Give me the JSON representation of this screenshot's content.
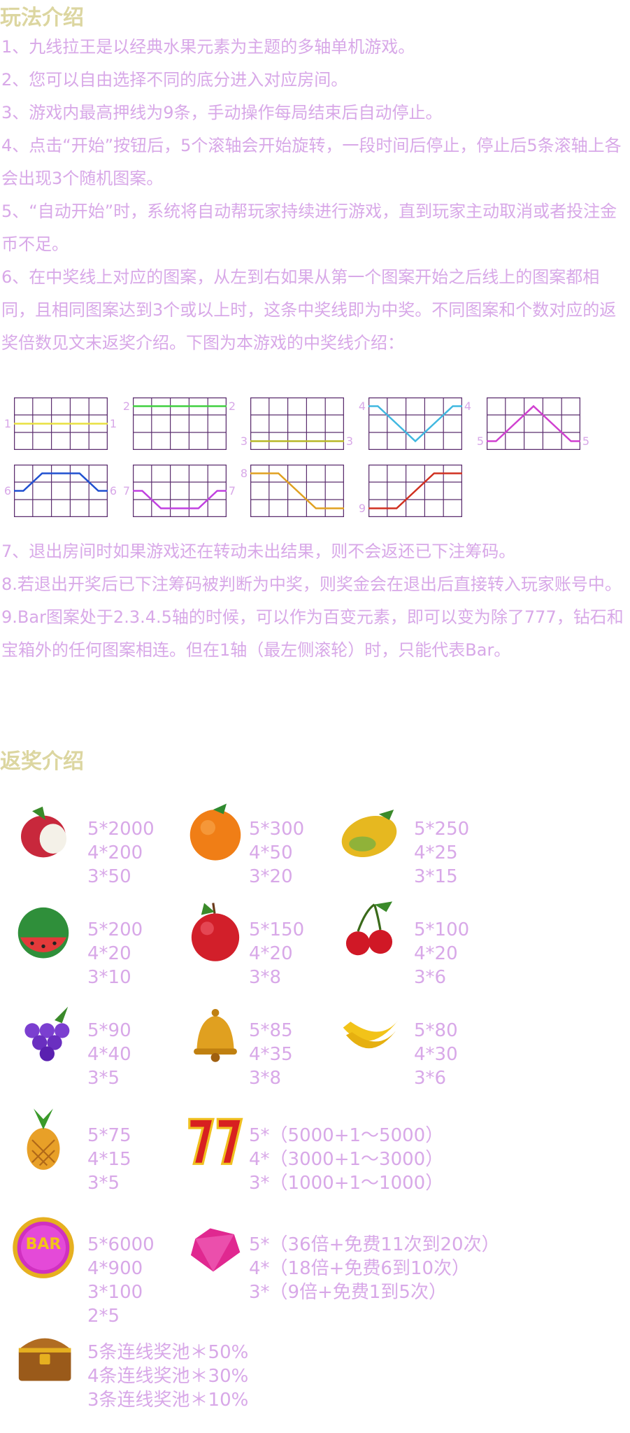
{
  "headings": {
    "rules": "玩法介绍",
    "payouts": "返奖介绍"
  },
  "rules": [
    "1、九线拉王是以经典水果元素为主题的多轴单机游戏。",
    "2、您可以自由选择不同的底分进入对应房间。",
    "3、游戏内最高押线为9条，手动操作每局结束后自动停止。",
    "4、点击“开始”按钮后，5个滚轴会开始旋转，一段时间后停止，停止后5条滚轴上各会出现3个随机图案。",
    "5、“自动开始”时，系统将自动帮玩家持续进行游戏，直到玩家主动取消或者投注金币不足。",
    "6、在中奖线上对应的图案，从左到右如果从第一个图案开始之后线上的图案都相同，且相同图案达到3个或以上时，这条中奖线即为中奖。不同图案和个数对应的返奖倍数见文末返奖介绍。下图为本游戏的中奖线介绍：",
    "7、退出房间时如果游戏还在转动未出结果，则不会返还已下注筹码。",
    "8.若退出开奖后已下注筹码被判断为中奖，则奖金会在退出后直接转入玩家账号中。",
    "9.Bar图案处于2.3.4.5轴的时候，可以作为百变元素，即可以变为除了777，钻石和宝箱外的任何图案相连。但在1轴（最左侧滚轮）时，只能代表Bar。"
  ],
  "paylines": [
    {
      "label": "1",
      "color": "#e8e040"
    },
    {
      "label": "2",
      "color": "#40d040"
    },
    {
      "label": "3",
      "color": "#b8b828"
    },
    {
      "label": "4",
      "color": "#40b8e0"
    },
    {
      "label": "5",
      "color": "#d040d0"
    },
    {
      "label": "6",
      "color": "#2050d0"
    },
    {
      "label": "7",
      "color": "#c040e0"
    },
    {
      "label": "8",
      "color": "#e0a020"
    },
    {
      "label": "9",
      "color": "#d03020"
    }
  ],
  "payouts": [
    {
      "symbol": "lychee-icon",
      "lines": [
        "5*2000",
        "4*200",
        "3*50"
      ]
    },
    {
      "symbol": "orange-icon",
      "lines": [
        "5*300",
        "4*50",
        "3*20"
      ]
    },
    {
      "symbol": "mango-icon",
      "lines": [
        "5*250",
        "4*25",
        "3*15"
      ]
    },
    {
      "symbol": "watermelon-icon",
      "lines": [
        "5*200",
        "4*20",
        "3*10"
      ]
    },
    {
      "symbol": "apple-icon",
      "lines": [
        "5*150",
        "4*20",
        "3*8"
      ]
    },
    {
      "symbol": "cherry-icon",
      "lines": [
        "5*100",
        "4*20",
        "3*6"
      ]
    },
    {
      "symbol": "grapes-icon",
      "lines": [
        "5*90",
        "4*40",
        "3*5"
      ]
    },
    {
      "symbol": "bell-icon",
      "lines": [
        "5*85",
        "4*35",
        "3*8"
      ]
    },
    {
      "symbol": "banana-icon",
      "lines": [
        "5*80",
        "4*30",
        "3*6"
      ]
    },
    {
      "symbol": "pineapple-icon",
      "lines": [
        "5*75",
        "4*15",
        "3*5"
      ]
    },
    {
      "symbol": "seven-icon",
      "lines": [
        "5*（5000+1～5000）",
        "4*（3000+1～3000）",
        "3*（1000+1～1000）"
      ]
    },
    {
      "symbol": "bar-icon",
      "label": "BAR",
      "lines": [
        "5*6000",
        "4*900",
        "3*100",
        "2*5"
      ]
    },
    {
      "symbol": "diamond-icon",
      "lines": [
        "5*（36倍+免费11次到20次）",
        "4*（18倍+免费6到10次）",
        "3*（9倍+免费1到5次）"
      ]
    },
    {
      "symbol": "treasure-chest-icon",
      "lines": [
        "5条连线奖池＊50%",
        "4条连线奖池＊30%",
        "3条连线奖池＊10%"
      ]
    }
  ]
}
